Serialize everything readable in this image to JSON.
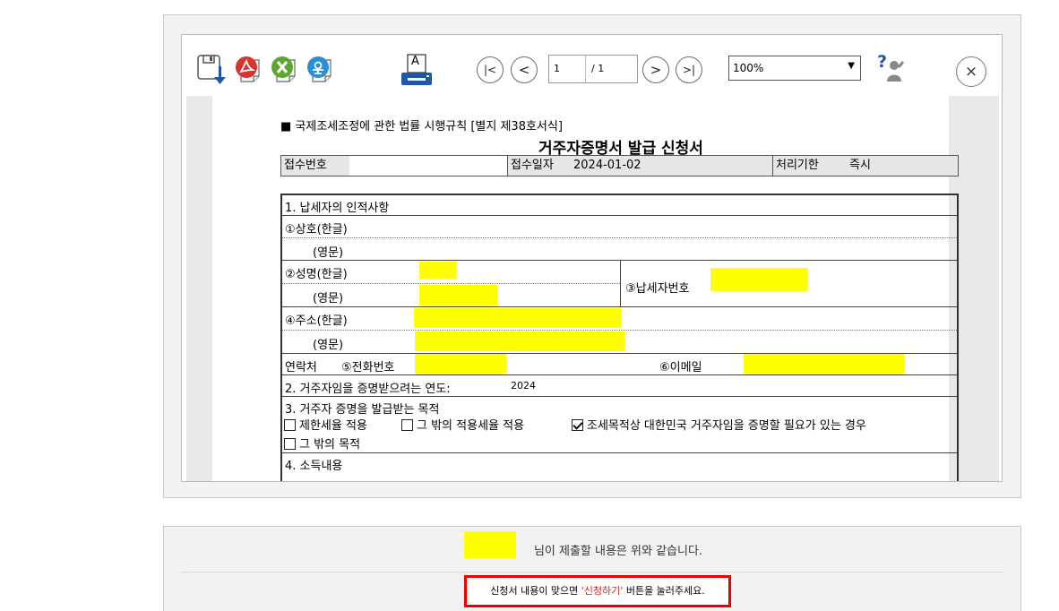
{
  "toolbar": {
    "icons": [
      "save-icon",
      "pdf-icon",
      "excel-icon",
      "hwp-icon",
      "print-icon",
      "help-icon"
    ],
    "print_glyph": "A",
    "nav_first": "|<",
    "nav_prev": "<",
    "nav_next": ">",
    "nav_last": ">|",
    "current_page": "1",
    "total_pages": "/ 1",
    "zoom": "100%",
    "close": "×"
  },
  "document": {
    "ref": "■ 국제조세조정에 관한 법률 시행규칙 [별지 제38호서식]",
    "title": "거주자증명서 발급 신청서",
    "receipt": {
      "no_label": "접수번호",
      "date_label": "접수일자",
      "date_value": "2024-01-02",
      "deadline_label": "처리기한",
      "deadline_value": "즉시"
    },
    "section1": "1. 납세자의 인적사항",
    "company_kr": "①상호(한글)",
    "company_en": "(영문)",
    "name_kr": "②성명(한글)",
    "name_en": "(영문)",
    "taxpayer_no": "③납세자번호",
    "address_kr": "④주소(한글)",
    "address_en": "(영문)",
    "contact": "연락처",
    "phone": "⑤전화번호",
    "email": "⑥이메일",
    "section2": "2. 거주자임을 증명받으려는 연도:",
    "year": "2024",
    "section3": "3. 거주자 증명을 발급받는 목적",
    "purpose_options": [
      {
        "label": "제한세율 적용",
        "checked": false
      },
      {
        "label": "그 밖의 적용세율 적용",
        "checked": false
      },
      {
        "label": "조세목적상 대한민국 거주자임을 증명할 필요가 있는 경우",
        "checked": true
      },
      {
        "label": "그 밖의 목적",
        "checked": false
      }
    ],
    "section4": "4. 소득내용"
  },
  "footer": {
    "statement": "님이 제출할 내용은 위와 같습니다.",
    "notice_pre": "신청서 내용이 맞으면 ",
    "notice_highlight": "'신청하기'",
    "notice_post": " 버튼을 눌러주세요."
  },
  "colors": {
    "highlight": "#ffff00",
    "notice_border": "#ee0000",
    "notice_red": "#e02020",
    "pdf_red": "#d9342b",
    "excel_green": "#5aa832",
    "hwp_blue": "#2a8fd6",
    "print_blue": "#1f57a8"
  }
}
